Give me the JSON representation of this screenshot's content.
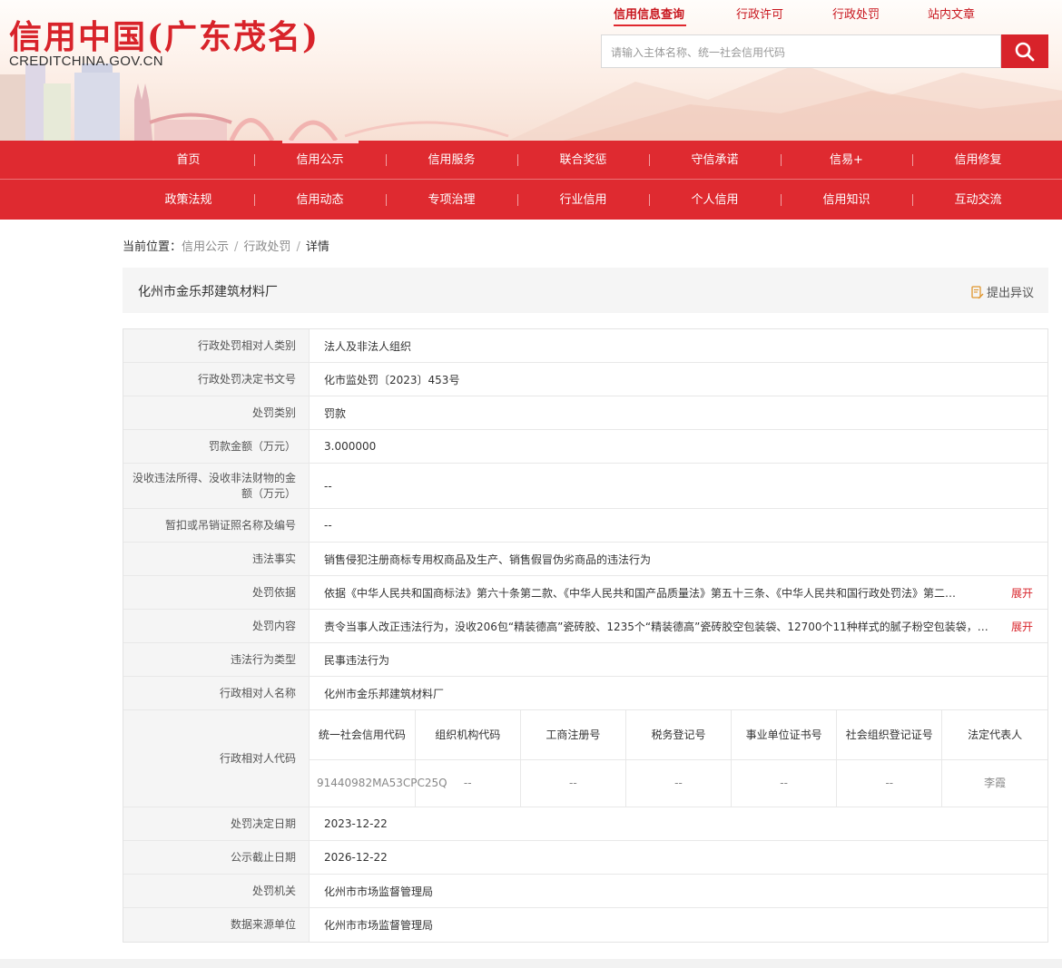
{
  "header": {
    "logo_main": "信用中国(广东茂名)",
    "logo_sub": "CREDITCHINA.GOV.CN",
    "top_links": [
      {
        "label": "信用信息查询",
        "active": true
      },
      {
        "label": "行政许可",
        "active": false
      },
      {
        "label": "行政处罚",
        "active": false
      },
      {
        "label": "站内文章",
        "active": false
      }
    ],
    "search_placeholder": "请输入主体名称、统一社会信用代码",
    "search_icon": "search-icon"
  },
  "nav": {
    "row1": [
      "首页",
      "信用公示",
      "信用服务",
      "联合奖惩",
      "守信承诺",
      "信易+",
      "信用修复"
    ],
    "row2": [
      "政策法规",
      "信用动态",
      "专项治理",
      "行业信用",
      "个人信用",
      "信用知识",
      "互动交流"
    ],
    "active": "信用公示"
  },
  "breadcrumb": {
    "prefix": "当前位置：",
    "items": [
      "信用公示",
      "行政处罚",
      "详情"
    ]
  },
  "title_bar": {
    "title": "化州市金乐邦建筑材料厂",
    "objection_label": "提出异议",
    "objection_icon": "edit-document-icon"
  },
  "details": {
    "expand_label": "展开",
    "rows": [
      {
        "label": "行政处罚相对人类别",
        "value": "法人及非法人组织"
      },
      {
        "label": "行政处罚决定书文号",
        "value": "化市监处罚〔2023〕453号"
      },
      {
        "label": "处罚类别",
        "value": "罚款"
      },
      {
        "label": "罚款金额（万元）",
        "value": "3.000000"
      },
      {
        "label": "没收违法所得、没收非法财物的金额（万元）",
        "value": "--"
      },
      {
        "label": "暂扣或吊销证照名称及编号",
        "value": "--"
      },
      {
        "label": "违法事实",
        "value": "销售侵犯注册商标专用权商品及生产、销售假冒伪劣商品的违法行为"
      },
      {
        "label": "处罚依据",
        "value": "依据《中华人民共和国商标法》第六十条第二款、《中华人民共和国产品质量法》第五十三条、《中华人民共和国行政处罚法》第二…"
      },
      {
        "label": "处罚内容",
        "value": "责令当事人改正违法行为，没收206包“精装德高”瓷砖胶、1235个“精装德高”瓷砖胶空包装袋、12700个11种样式的腻子粉空包装袋，…"
      },
      {
        "label": "违法行为类型",
        "value": "民事违法行为"
      },
      {
        "label": "行政相对人名称",
        "value": "化州市金乐邦建筑材料厂"
      }
    ],
    "code_row": {
      "label": "行政相对人代码",
      "headers": [
        "统一社会信用代码",
        "组织机构代码",
        "工商注册号",
        "税务登记号",
        "事业单位证书号",
        "社会组织登记证号",
        "法定代表人"
      ],
      "values": [
        "91440982MA53CPC25Q",
        "--",
        "--",
        "--",
        "--",
        "--",
        "李霞"
      ]
    },
    "rows_after": [
      {
        "label": "处罚决定日期",
        "value": "2023-12-22"
      },
      {
        "label": "公示截止日期",
        "value": "2026-12-22"
      },
      {
        "label": "处罚机关",
        "value": "化州市市场监督管理局"
      },
      {
        "label": "数据来源单位",
        "value": "化州市市场监督管理局"
      }
    ]
  }
}
